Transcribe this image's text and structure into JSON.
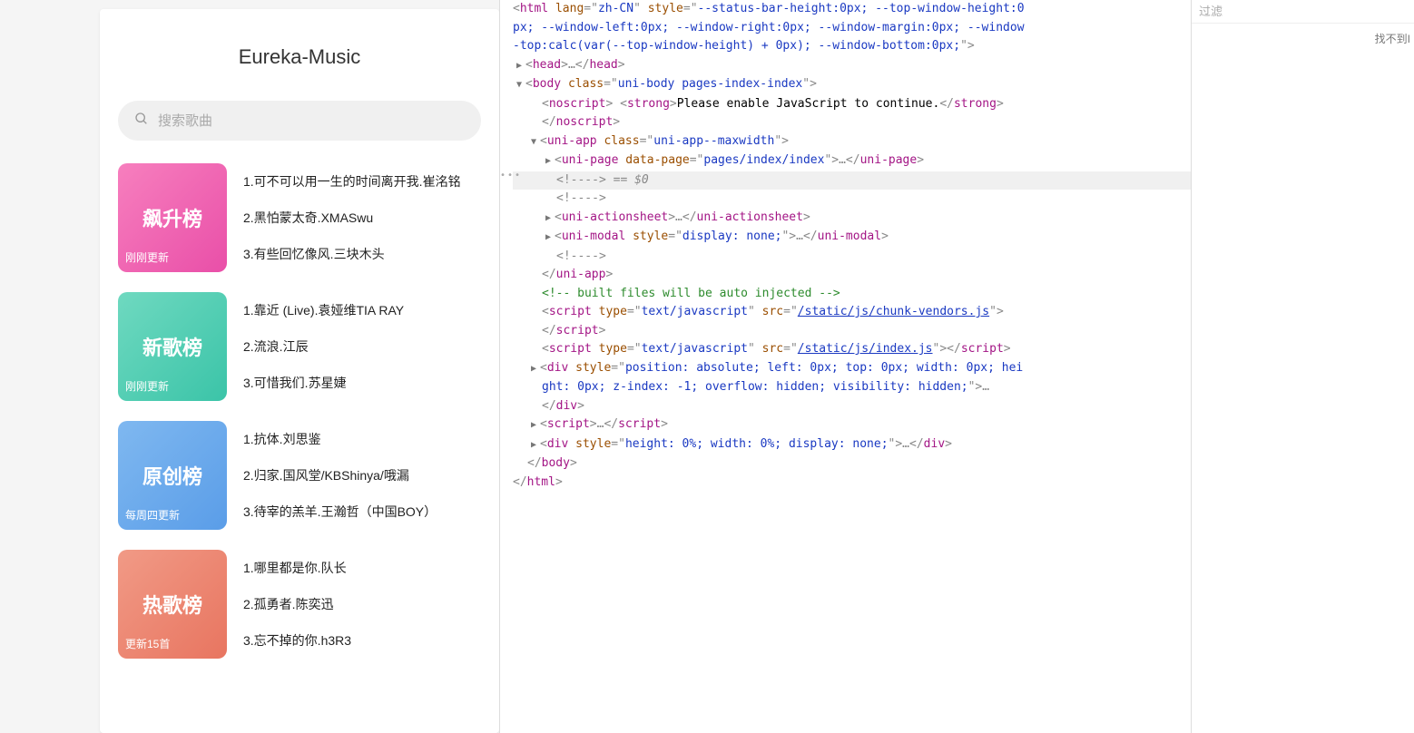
{
  "app": {
    "title": "Eureka-Music",
    "search_placeholder": "搜索歌曲",
    "charts": [
      {
        "tile_class": "tile-pink",
        "name": "飙升榜",
        "subtitle": "刚刚更新",
        "songs": [
          "1.可不可以用一生的时间离开我.崔洺铭",
          "2.黑怕蒙太奇.XMASwu",
          "3.有些回忆像风.三块木头"
        ]
      },
      {
        "tile_class": "tile-teal",
        "name": "新歌榜",
        "subtitle": "刚刚更新",
        "songs": [
          "1.靠近 (Live).袁娅维TIA RAY",
          "2.流浪.江辰",
          "3.可惜我们.苏星婕"
        ]
      },
      {
        "tile_class": "tile-blue",
        "name": "原创榜",
        "subtitle": "每周四更新",
        "songs": [
          "1.抗体.刘思鉴",
          "2.归家.国风堂/KBShinya/哦漏",
          "3.待宰的羔羊.王瀚哲（中国BOY）"
        ]
      },
      {
        "tile_class": "tile-red",
        "name": "热歌榜",
        "subtitle": "更新15首",
        "songs": [
          "1.哪里都是你.队长",
          "2.孤勇者.陈奕迅",
          "3.忘不掉的你.h3R3"
        ]
      }
    ]
  },
  "devtools": {
    "filter_placeholder": "过滤",
    "side_message": "找不到I",
    "code": {
      "l0a": "<html lang=\"zh-CN\" style=\"--status-bar-height:0px; --top-window-height:0",
      "l0b": "px; --window-left:0px; --window-right:0px; --window-margin:0px; --window",
      "l0c": "-top:calc(var(--top-window-height) + 0px); --window-bottom:0px;\">",
      "head": "<head>…</head>",
      "body_open": "<body class=\"uni-body pages-index-index\">",
      "noscript_open": "<noscript> <strong>Please enable JavaScript to continue.</strong>",
      "noscript_close": "</noscript>",
      "uniapp_open": "<uni-app class=\"uni-app--maxwidth\">",
      "unipage": "<uni-page data-page=\"pages/index/index\">…</uni-page>",
      "comment_eq": "<!----> == $0",
      "comment_empty": "<!---->",
      "uniaction": "<uni-actionsheet>…</uni-actionsheet>",
      "unimodal": "<uni-modal style=\"display: none;\">…</uni-modal>",
      "uniapp_close": "</uni-app>",
      "built_cmt": "<!-- built files will be auto injected -->",
      "script1a": "<script type=\"text/javascript\" src=\"",
      "script1link": "/static/js/chunk-vendors.js",
      "script1b": "\">",
      "script_close": "</script>",
      "script2a": "<script type=\"text/javascript\" src=\"",
      "script2link": "/static/js/index.js",
      "script2b": "\"></script>",
      "div1a": "<div style=\"position: absolute; left: 0px; top: 0px; width: 0px; hei",
      "div1b": "ght: 0px; z-index: -1; overflow: hidden; visibility: hidden;\">…",
      "div1c": "</div>",
      "script3": "<script>…</script>",
      "div2": "<div style=\"height: 0%; width: 0%; display: none;\">…</div>",
      "body_close": "</body>",
      "html_close": "</html>"
    }
  }
}
